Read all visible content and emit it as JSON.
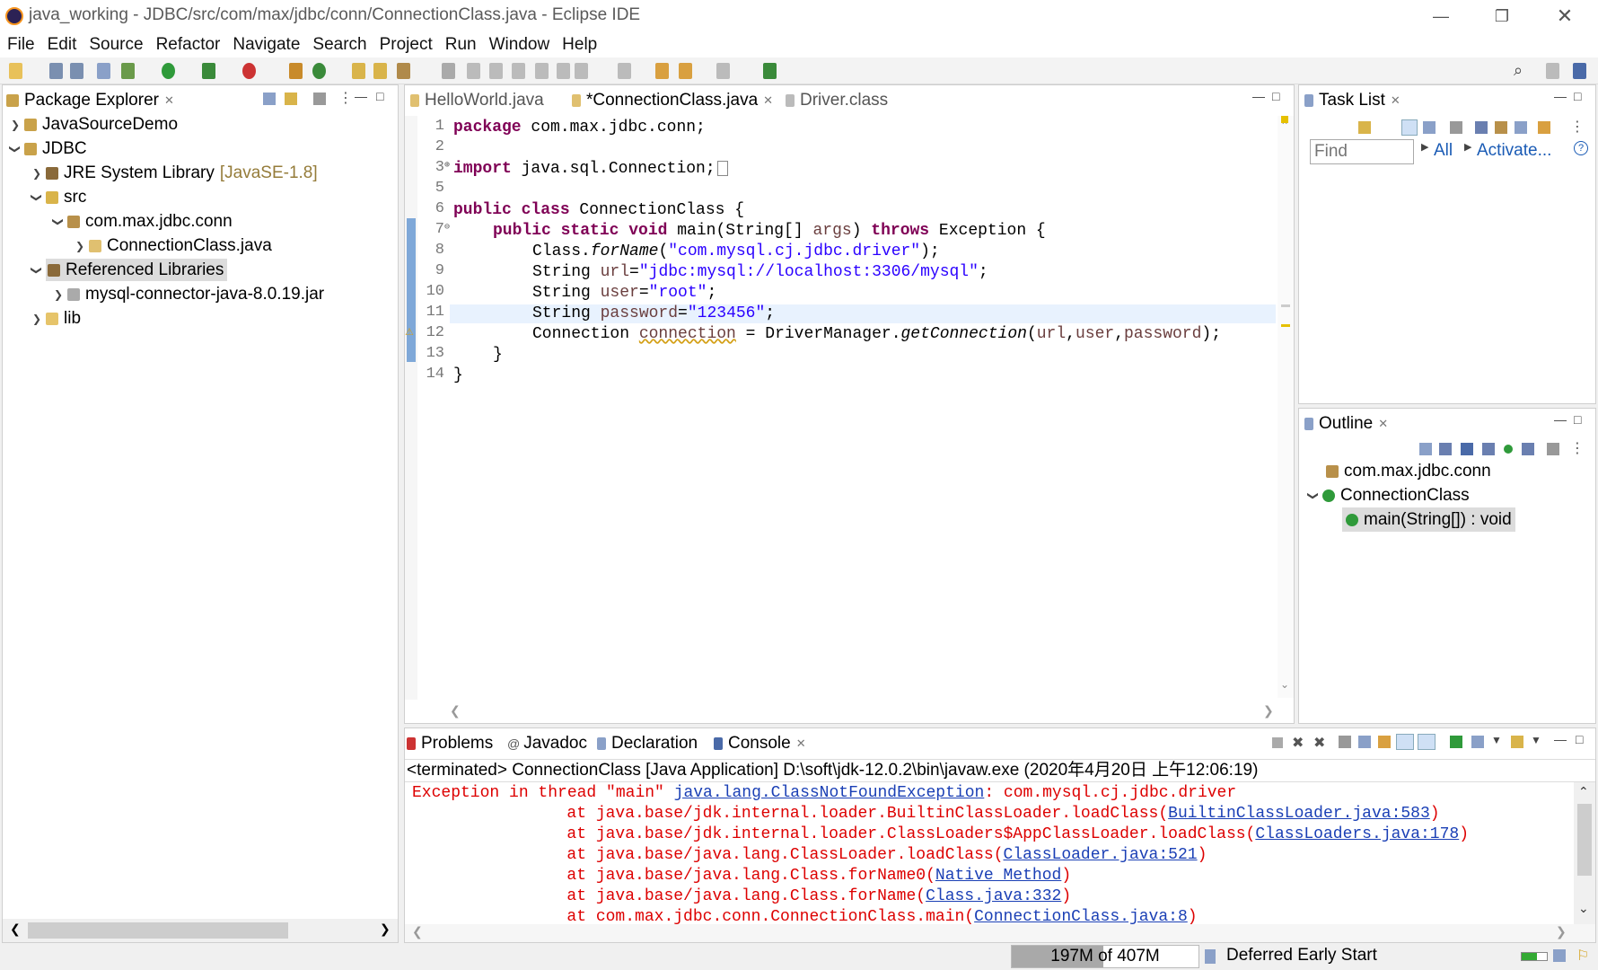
{
  "window": {
    "title": "java_working - JDBC/src/com/max/jdbc/conn/ConnectionClass.java - Eclipse IDE"
  },
  "menu": [
    "File",
    "Edit",
    "Source",
    "Refactor",
    "Navigate",
    "Search",
    "Project",
    "Run",
    "Window",
    "Help"
  ],
  "package_explorer": {
    "title": "Package Explorer",
    "items": [
      {
        "label": "JavaSourceDemo",
        "extra": ""
      },
      {
        "label": "JDBC",
        "extra": ""
      },
      {
        "label": "JRE System Library",
        "extra": "[JavaSE-1.8]"
      },
      {
        "label": "src",
        "extra": ""
      },
      {
        "label": "com.max.jdbc.conn",
        "extra": ""
      },
      {
        "label": "ConnectionClass.java",
        "extra": ""
      },
      {
        "label": "Referenced Libraries",
        "extra": ""
      },
      {
        "label": "mysql-connector-java-8.0.19.jar",
        "extra": ""
      },
      {
        "label": "lib",
        "extra": ""
      }
    ]
  },
  "editor": {
    "tabs": [
      {
        "label": "HelloWorld.java"
      },
      {
        "label": "*ConnectionClass.java"
      },
      {
        "label": "Driver.class"
      }
    ],
    "line_numbers": [
      "1",
      "2",
      "3",
      "5",
      "6",
      "7",
      "8",
      "9",
      "10",
      "11",
      "12",
      "13",
      "14"
    ],
    "code": {
      "l1_kw": "package",
      "l1_rest": " com.max.jdbc.conn;",
      "l3_kw": "import",
      "l3_rest": " java.sql.Connection;",
      "l6_kw": "public class",
      "l6_rest": " ConnectionClass {",
      "l7_kw": "public static void",
      "l7_a": " main(String[] ",
      "l7_var": "args",
      "l7_b": ") ",
      "l7_kw2": "throws",
      "l7_c": " Exception {",
      "l8_a": "Class.",
      "l8_it": "forName",
      "l8_b": "(",
      "l8_str": "\"com.mysql.cj.jdbc.driver\"",
      "l8_c": ");",
      "l9_a": "String ",
      "l9_var": "url",
      "l9_b": "=",
      "l9_str": "\"jdbc:mysql://localhost:3306/mysql\"",
      "l9_c": ";",
      "l10_a": "String ",
      "l10_var": "user",
      "l10_b": "=",
      "l10_str": "\"root\"",
      "l10_c": ";",
      "l11_a": "String ",
      "l11_var": "password",
      "l11_b": "=",
      "l11_str": "\"123456\"",
      "l11_c": ";",
      "l12_a": "Connection ",
      "l12_var": "connection",
      "l12_b": " = DriverManager.",
      "l12_it": "getConnection",
      "l12_c": "(",
      "l12_v1": "url",
      "l12_s1": ",",
      "l12_v2": "user",
      "l12_s2": ",",
      "l12_v3": "password",
      "l12_d": ");",
      "l13": "}",
      "l14": "}"
    }
  },
  "task_list": {
    "title": "Task List",
    "find_placeholder": "Find",
    "all": "All",
    "activate": "Activate..."
  },
  "outline": {
    "title": "Outline",
    "items": [
      {
        "label": "com.max.jdbc.conn"
      },
      {
        "label": "ConnectionClass"
      },
      {
        "label": "main(String[]) : void"
      }
    ]
  },
  "bottom_tabs": [
    {
      "label": "Problems"
    },
    {
      "label": "Javadoc"
    },
    {
      "label": "Declaration"
    },
    {
      "label": "Console"
    }
  ],
  "console": {
    "header": "<terminated> ConnectionClass [Java Application] D:\\soft\\jdk-12.0.2\\bin\\javaw.exe (2020年4月20日 上午12:06:19)",
    "l1_a": "Exception in thread \"main\" ",
    "l1_link": "java.lang.ClassNotFoundException",
    "l1_b": ": com.mysql.cj.jdbc.driver",
    "l2_a": "\tat java.base/jdk.internal.loader.BuiltinClassLoader.loadClass(",
    "l2_link": "BuiltinClassLoader.java:583",
    "l2_b": ")",
    "l3_a": "\tat java.base/jdk.internal.loader.ClassLoaders$AppClassLoader.loadClass(",
    "l3_link": "ClassLoaders.java:178",
    "l3_b": ")",
    "l4_a": "\tat java.base/java.lang.ClassLoader.loadClass(",
    "l4_link": "ClassLoader.java:521",
    "l4_b": ")",
    "l5_a": "\tat java.base/java.lang.Class.forName0(",
    "l5_link": "Native Method",
    "l5_b": ")",
    "l6_a": "\tat java.base/java.lang.Class.forName(",
    "l6_link": "Class.java:332",
    "l6_b": ")",
    "l7_a": "\tat com.max.jdbc.conn.ConnectionClass.main(",
    "l7_link": "ConnectionClass.java:8",
    "l7_b": ")"
  },
  "status": {
    "memory": "197M of 407M",
    "job": "Deferred Early Start"
  }
}
